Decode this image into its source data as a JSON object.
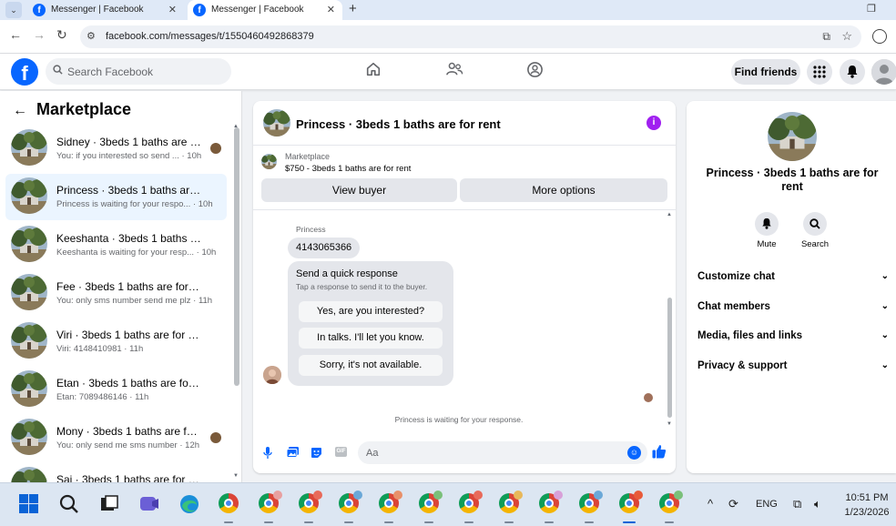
{
  "browser": {
    "tabs": [
      {
        "title": "Messenger | Facebook",
        "active": false
      },
      {
        "title": "Messenger | Facebook",
        "active": true
      }
    ],
    "url": "facebook.com/messages/t/1550460492868379"
  },
  "header": {
    "search_placeholder": "Search Facebook",
    "find_friends_label": "Find friends"
  },
  "sidebar": {
    "title": "Marketplace",
    "conversations": [
      {
        "name": "Sidney · 3beds 1 baths are for ...",
        "snippet": "You: if you interested so send ... · 10h",
        "seen_avatar": true,
        "selected": false
      },
      {
        "name": "Princess · 3beds 1 baths are for r...",
        "snippet": "Princess is waiting for your respo... · 10h",
        "seen_avatar": false,
        "selected": true
      },
      {
        "name": "Keeshanta · 3beds 1 baths are fo...",
        "snippet": "Keeshanta is waiting for your resp... · 10h",
        "seen_avatar": false,
        "selected": false
      },
      {
        "name": "Fee · 3beds 1 baths are for rent",
        "snippet": "You: only sms number send me plz · 11h",
        "seen_avatar": false,
        "selected": false
      },
      {
        "name": "Viri · 3beds 1 baths are for rent",
        "snippet": "Viri: 4148410981 · 11h",
        "seen_avatar": false,
        "selected": false
      },
      {
        "name": "Etan · 3beds 1 baths are for rent",
        "snippet": "Etan: 7089486146 · 11h",
        "seen_avatar": false,
        "selected": false
      },
      {
        "name": "Mony · 3beds 1 baths are for r...",
        "snippet": "You: only send me sms number · 12h",
        "seen_avatar": true,
        "selected": false
      },
      {
        "name": "Sai · 3beds 1 baths are for rent",
        "snippet": "",
        "seen_avatar": false,
        "selected": false
      }
    ]
  },
  "chat": {
    "title": "Princess · 3beds 1 baths are for rent",
    "marketplace_label": "Marketplace",
    "listing": "$750 - 3beds 1 baths are for rent",
    "view_buyer_label": "View buyer",
    "more_options_label": "More options",
    "sender": "Princess",
    "message": "4143065366",
    "quick_response": {
      "title": "Send a quick response",
      "subtitle": "Tap a response to send it to the buyer.",
      "options": [
        "Yes, are you interested?",
        "In talks. I'll let you know.",
        "Sorry, it's not available."
      ]
    },
    "waiting_text": "Princess is waiting for your response.",
    "composer_placeholder": "Aa"
  },
  "info_panel": {
    "name": "Princess · 3beds 1 baths are for rent",
    "actions": [
      {
        "label": "Mute",
        "icon": "bell-icon"
      },
      {
        "label": "Search",
        "icon": "search-icon"
      }
    ],
    "sections": [
      "Customize chat",
      "Chat members",
      "Media, files and links",
      "Privacy & support"
    ]
  },
  "taskbar": {
    "language": "ENG",
    "time": "10:51 PM",
    "date": "1/23/2026"
  },
  "colors": {
    "facebook_blue": "#0866ff",
    "selected_row": "#ebf5ff",
    "info_purple": "#a020f0"
  }
}
